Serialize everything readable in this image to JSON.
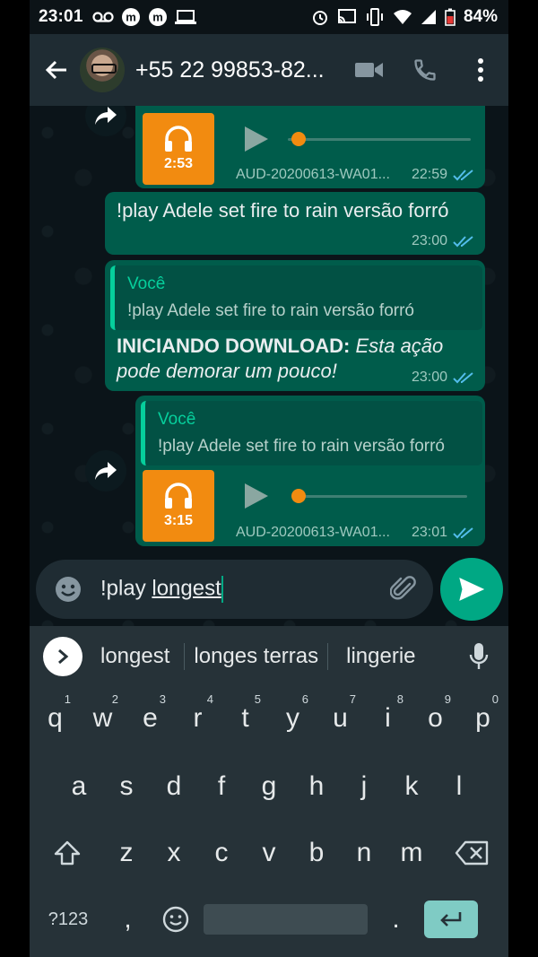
{
  "status_bar": {
    "time": "23:01",
    "left_icons": [
      "voicemail-icon",
      "m-app-icon",
      "m-app-icon",
      "laptop-icon"
    ],
    "right_icons": [
      "alarm-icon",
      "cast-icon",
      "vibrate-icon",
      "wifi-icon",
      "signal-icon",
      "battery-icon"
    ],
    "battery": "84%"
  },
  "toolbar": {
    "contact_name": "+55 22 99853-82..."
  },
  "messages": [
    {
      "type": "audio",
      "duration": "2:53",
      "filename": "AUD-20200613-WA01...",
      "time": "22:59"
    },
    {
      "type": "text",
      "text": "!play Adele set fire to rain versão forró",
      "time": "23:00"
    },
    {
      "type": "reply",
      "quote_author": "Você",
      "quote_text": "!play Adele set fire to rain versão forró",
      "bold_prefix": "INICIANDO DOWNLOAD:",
      "italic_text": "Esta ação pode demorar um pouco!",
      "time": "23:00"
    },
    {
      "type": "audio_reply",
      "quote_author": "Você",
      "quote_text": "!play Adele set fire to rain versão forró",
      "duration": "3:15",
      "filename": "AUD-20200613-WA01...",
      "time": "23:01"
    }
  ],
  "input": {
    "prefix": "!play ",
    "word": "longest"
  },
  "suggestions": [
    "longest",
    "longes terras",
    "lingerie"
  ],
  "keyboard": {
    "row1": [
      {
        "k": "q",
        "n": "1"
      },
      {
        "k": "w",
        "n": "2"
      },
      {
        "k": "e",
        "n": "3"
      },
      {
        "k": "r",
        "n": "4"
      },
      {
        "k": "t",
        "n": "5"
      },
      {
        "k": "y",
        "n": "6"
      },
      {
        "k": "u",
        "n": "7"
      },
      {
        "k": "i",
        "n": "8"
      },
      {
        "k": "o",
        "n": "9"
      },
      {
        "k": "p",
        "n": "0"
      }
    ],
    "row2": [
      "a",
      "s",
      "d",
      "f",
      "g",
      "h",
      "j",
      "k",
      "l"
    ],
    "row3": [
      "z",
      "x",
      "c",
      "v",
      "b",
      "n",
      "m"
    ],
    "symbols_key": "?123",
    "comma": ",",
    "period": "."
  },
  "colors": {
    "outgoing_bubble": "#005c4b",
    "accent": "#00a884",
    "audio_orange": "#f28b10",
    "read_ticks": "#53bdeb"
  }
}
